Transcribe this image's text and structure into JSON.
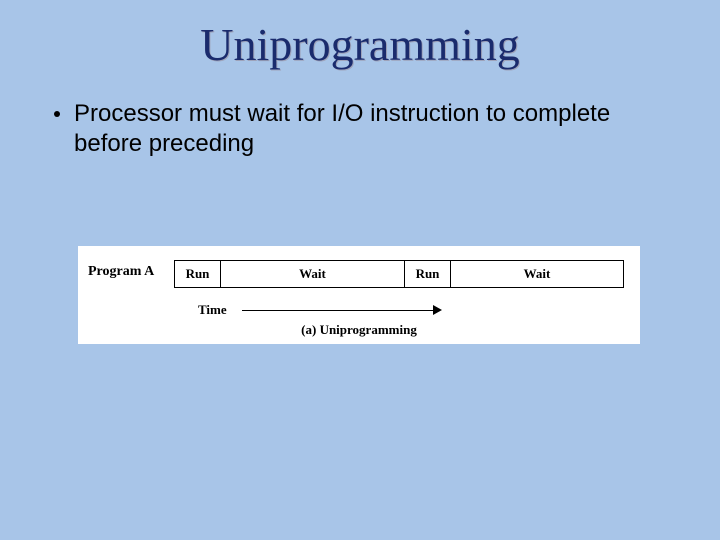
{
  "title": "Uniprogramming",
  "bullets": [
    "Processor must wait for I/O instruction to complete before preceding"
  ],
  "diagram": {
    "program_label": "Program A",
    "segments": {
      "run1": "Run",
      "wait1": "Wait",
      "run2": "Run",
      "wait2": "Wait"
    },
    "time_label": "Time",
    "caption": "(a) Uniprogramming"
  }
}
